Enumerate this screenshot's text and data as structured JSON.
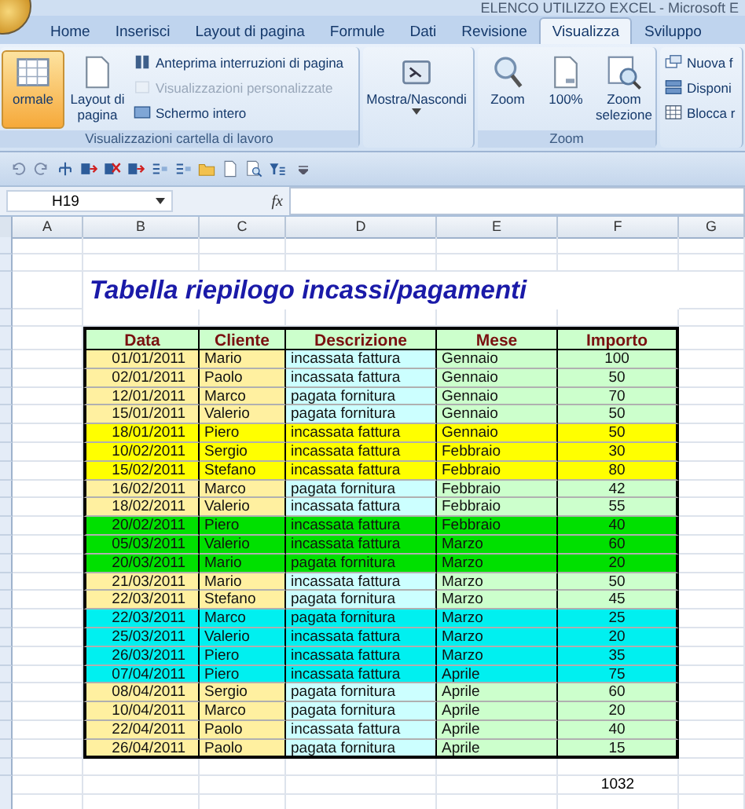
{
  "window": {
    "title": "ELENCO UTILIZZO EXCEL - Microsoft E"
  },
  "ribbon_tabs": [
    {
      "label": "Home",
      "selected": false
    },
    {
      "label": "Inserisci",
      "selected": false
    },
    {
      "label": "Layout di pagina",
      "selected": false
    },
    {
      "label": "Formule",
      "selected": false
    },
    {
      "label": "Dati",
      "selected": false
    },
    {
      "label": "Revisione",
      "selected": false
    },
    {
      "label": "Visualizza",
      "selected": true
    },
    {
      "label": "Sviluppo",
      "selected": false
    }
  ],
  "ribbon_groups": [
    {
      "label": "Visualizzazioni cartella di lavoro",
      "large": [
        {
          "label": "ormale",
          "selected": true
        },
        {
          "label": "Layout di pagina",
          "selected": false
        }
      ],
      "small": [
        {
          "label": "Anteprima interruzioni di pagina",
          "disabled": false
        },
        {
          "label": "Visualizzazioni personalizzate",
          "disabled": true
        },
        {
          "label": "Schermo intero",
          "disabled": false
        }
      ]
    },
    {
      "large": [
        {
          "label": "Mostra/Nascondi",
          "dropdown": true
        }
      ]
    },
    {
      "label": "Zoom",
      "large": [
        {
          "label": "Zoom"
        },
        {
          "label": "100%"
        },
        {
          "label": "Zoom selezione"
        }
      ]
    },
    {
      "small": [
        {
          "label": "Nuova f",
          "disabled": false
        },
        {
          "label": "Disponi",
          "disabled": false
        },
        {
          "label": "Blocca r",
          "disabled": false
        }
      ]
    }
  ],
  "formula_bar": {
    "name_box": "H19",
    "fx": "fx"
  },
  "sheet": {
    "columns": [
      "A",
      "B",
      "C",
      "D",
      "E",
      "F",
      "G"
    ],
    "title": "Tabella riepilogo incassi/pagamenti",
    "table": {
      "columns": [
        "Data",
        "Cliente",
        "Descrizione",
        "Mese",
        "Importo"
      ],
      "rows": [
        {
          "cells": [
            "01/01/2011",
            "Mario",
            "incassata fattura",
            "Gennaio",
            "100"
          ]
        },
        {
          "cells": [
            "02/01/2011",
            "Paolo",
            "incassata fattura",
            "Gennaio",
            "50"
          ]
        },
        {
          "cells": [
            "12/01/2011",
            "Marco",
            "pagata fornitura",
            "Gennaio",
            "70"
          ]
        },
        {
          "cells": [
            "15/01/2011",
            "Valerio",
            "pagata fornitura",
            "Gennaio",
            "50"
          ]
        },
        {
          "cells": [
            "18/01/2011",
            "Piero",
            "incassata fattura",
            "Gennaio",
            "50"
          ],
          "color": "#ffff00"
        },
        {
          "cells": [
            "10/02/2011",
            "Sergio",
            "incassata fattura",
            "Febbraio",
            "30"
          ],
          "color": "#ffff00"
        },
        {
          "cells": [
            "15/02/2011",
            "Stefano",
            "incassata fattura",
            "Febbraio",
            "80"
          ],
          "color": "#ffff00"
        },
        {
          "cells": [
            "16/02/2011",
            "Marco",
            "pagata fornitura",
            "Febbraio",
            "42"
          ]
        },
        {
          "cells": [
            "18/02/2011",
            "Valerio",
            "incassata fattura",
            "Febbraio",
            "55"
          ]
        },
        {
          "cells": [
            "20/02/2011",
            "Piero",
            "incassata fattura",
            "Febbraio",
            "40"
          ],
          "color": "#00e000"
        },
        {
          "cells": [
            "05/03/2011",
            "Valerio",
            "incassata fattura",
            "Marzo",
            "60"
          ],
          "color": "#00e000"
        },
        {
          "cells": [
            "20/03/2011",
            "Mario",
            "pagata fornitura",
            "Marzo",
            "20"
          ],
          "color": "#00e000"
        },
        {
          "cells": [
            "21/03/2011",
            "Mario",
            "incassata fattura",
            "Marzo",
            "50"
          ]
        },
        {
          "cells": [
            "22/03/2011",
            "Stefano",
            "pagata fornitura",
            "Marzo",
            "45"
          ]
        },
        {
          "cells": [
            "22/03/2011",
            "Marco",
            "pagata fornitura",
            "Marzo",
            "25"
          ],
          "color": "#00f0f0"
        },
        {
          "cells": [
            "25/03/2011",
            "Valerio",
            "incassata fattura",
            "Marzo",
            "20"
          ],
          "color": "#00f0f0"
        },
        {
          "cells": [
            "26/03/2011",
            "Piero",
            "incassata fattura",
            "Marzo",
            "35"
          ],
          "color": "#00f0f0"
        },
        {
          "cells": [
            "07/04/2011",
            "Piero",
            "incassata fattura",
            "Aprile",
            "75"
          ],
          "color": "#00f0f0"
        },
        {
          "cells": [
            "08/04/2011",
            "Sergio",
            "pagata fornitura",
            "Aprile",
            "60"
          ]
        },
        {
          "cells": [
            "10/04/2011",
            "Marco",
            "pagata fornitura",
            "Aprile",
            "20"
          ]
        },
        {
          "cells": [
            "22/04/2011",
            "Paolo",
            "incassata fattura",
            "Aprile",
            "40"
          ]
        },
        {
          "cells": [
            "26/04/2011",
            "Paolo",
            "pagata fornitura",
            "Aprile",
            "15"
          ]
        }
      ]
    },
    "total": "1032"
  }
}
